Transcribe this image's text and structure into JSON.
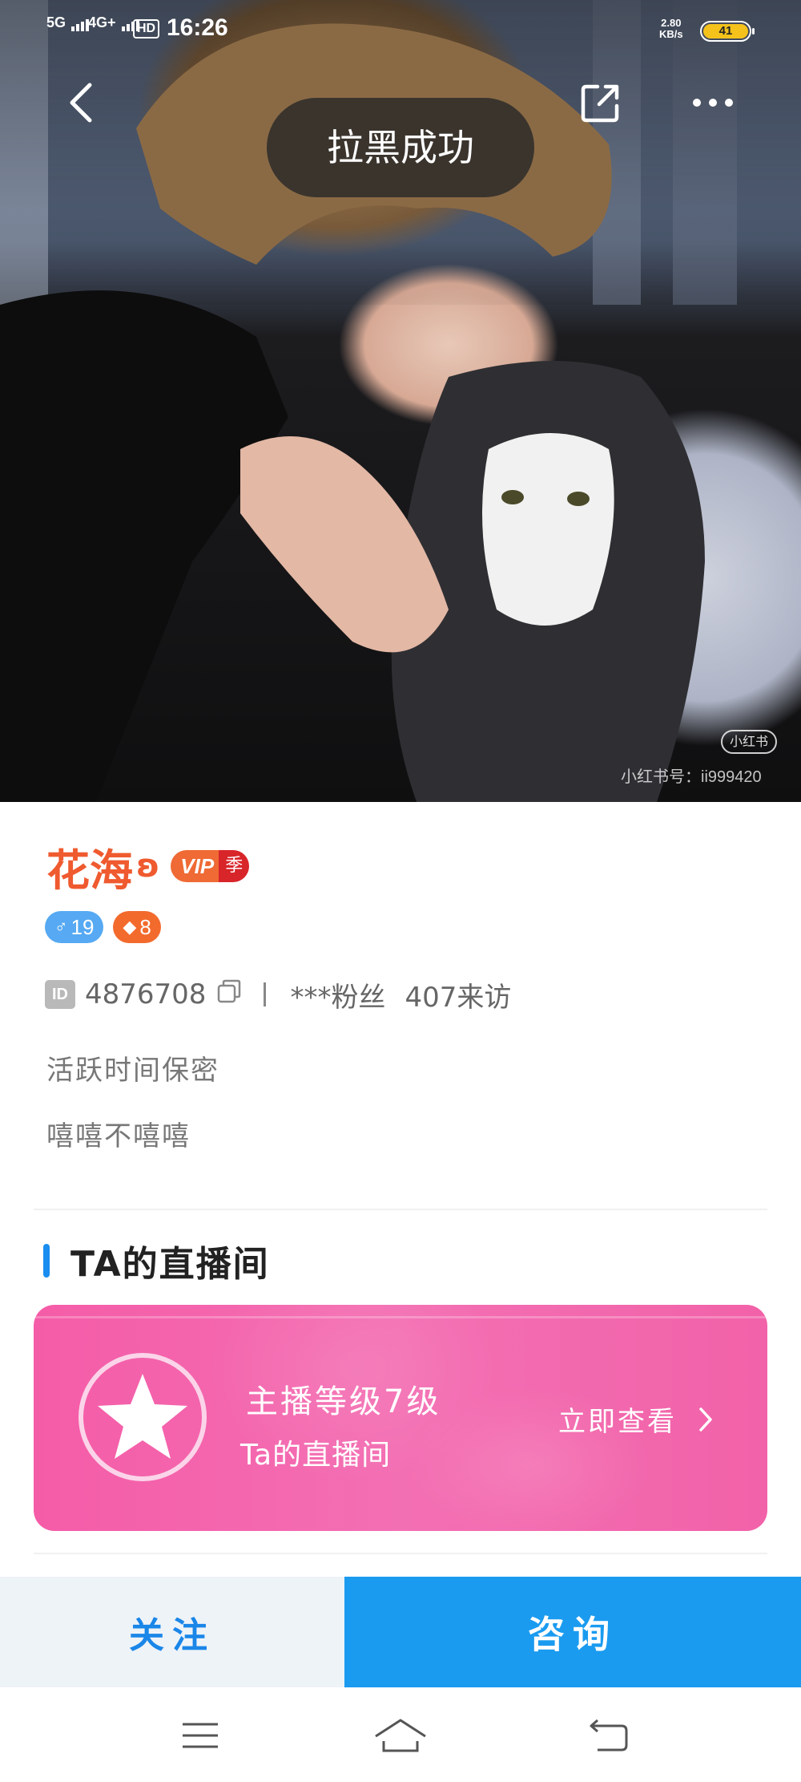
{
  "status_bar": {
    "signal_1": "5G",
    "signal_2": "4G+",
    "hd": "HD",
    "time": "16:26",
    "speed_value": "2.80",
    "speed_unit": "KB/s",
    "battery": "41"
  },
  "toast": {
    "text": "拉黑成功"
  },
  "hero": {
    "watermark_logo": "小红书",
    "watermark": "小红书号：ii999420"
  },
  "profile": {
    "name": "花海",
    "name_deco": "ʚ",
    "vip_label": "VIP",
    "vip_season": "季",
    "badge_gender_level": "19",
    "badge_wealth_level": "8",
    "id_tag": "ID",
    "id_value": "4876708",
    "fans": "***粉丝",
    "visits": "407来访",
    "active_status": "活跃时间保密",
    "bio": "嘻嘻不嘻嘻"
  },
  "live_section": {
    "title": "TA的直播间",
    "level_text": "主播等级7级",
    "subtitle": "Ta的直播间",
    "cta": "立即查看"
  },
  "actions": {
    "follow": "关注",
    "consult": "咨询"
  },
  "colors": {
    "accent_blue": "#1a9bf0",
    "name_orange": "#ef5a2f",
    "card_pink": "#f36fb3"
  },
  "icons": {
    "back": "chevron-left-icon",
    "share": "share-icon",
    "more": "more-dots-icon",
    "copy": "copy-icon",
    "star": "star-icon",
    "arrow": "chevron-right-icon",
    "menu": "menu-icon",
    "home": "home-icon",
    "return": "back-arrow-icon"
  }
}
